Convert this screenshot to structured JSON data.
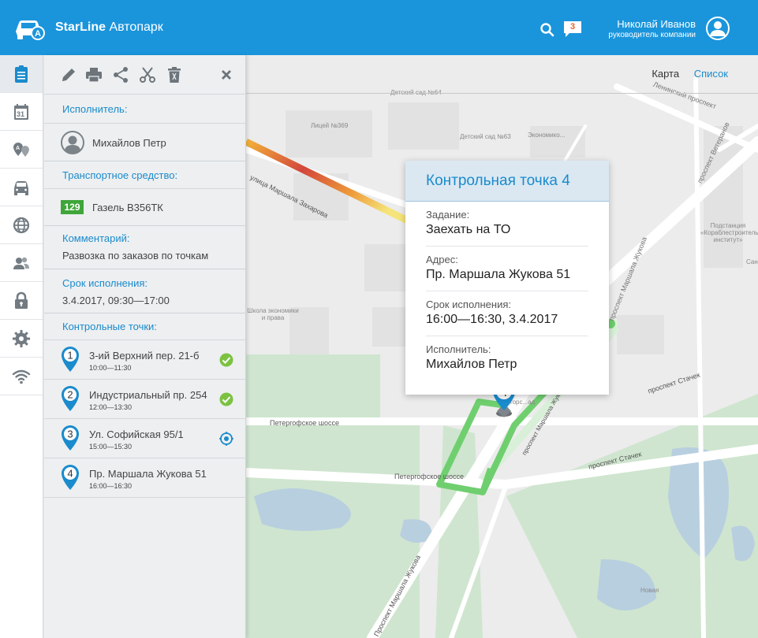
{
  "header": {
    "brand_bold": "StarLine",
    "brand_rest": " Автопарк",
    "messages_count": "3",
    "user_name": "Николай Иванов",
    "user_role": "руководитель компании"
  },
  "sidebar": {
    "items": [
      {
        "icon": "clipboard-icon",
        "active": true
      },
      {
        "icon": "calendar-icon",
        "label": "31"
      },
      {
        "icon": "route-ab-icon",
        "label": "A"
      },
      {
        "icon": "car-icon"
      },
      {
        "icon": "globe-icon"
      },
      {
        "icon": "users-icon"
      },
      {
        "icon": "lock-icon"
      },
      {
        "icon": "gear-icon"
      },
      {
        "icon": "wifi-icon"
      }
    ]
  },
  "panel": {
    "executor_label": "Исполнитель:",
    "executor_name": "Михайлов Петр",
    "vehicle_label": "Транспортное средство:",
    "vehicle_badge": "129",
    "vehicle_name": "Газель В356ТК",
    "comment_label": "Комментарий:",
    "comment_text": "Развозка по заказов по точкам",
    "deadline_label": "Срок исполнения:",
    "deadline_value": "3.4.2017, 09:30—17:00",
    "checkpoints_label": "Контрольные точки:",
    "checkpoints": [
      {
        "num": "1",
        "address": "3-ий Верхний пер. 21-б",
        "time": "10:00—11:30",
        "status": "done"
      },
      {
        "num": "2",
        "address": "Индустриальный пр. 254",
        "time": "12:00—13:30",
        "status": "done"
      },
      {
        "num": "3",
        "address": "Ул. Софийская 95/1",
        "time": "15:00—15:30",
        "status": "in-progress"
      },
      {
        "num": "4",
        "address": "Пр. Маршала Жукова 51",
        "time": "16:00—16:30",
        "status": "pending"
      }
    ]
  },
  "map": {
    "tab_map": "Карта",
    "tab_list": "Список",
    "labels": {
      "leninsky": "Ленинский проспект",
      "kindergarten64": "Детский сад №64",
      "lyceum369": "Лицей №369",
      "kindergarten63": "Детский сад №63",
      "economics": "Экономико...",
      "zakharova": "улица Маршала Захарова",
      "shipbuilding": "Подстанция «Кораблестроительный институт»",
      "veterans": "проспект Ветеранов",
      "zhukova_pr": "проспект Маршала Жукова",
      "school_econ": "Школа экономики и права",
      "stachek1": "проспект Стачек",
      "peterhof1": "Петергофское шоссе",
      "peterhof2": "Петергофское шоссе",
      "stachek2": "проспект Стачек",
      "zhukova_road": "Проспект Маршала Жукова",
      "novaya": "Новая",
      "zhukova_route": "проспект Маршала Жукова",
      "stores": "сторс...ад",
      "san": "Сан..."
    },
    "marker_number": "4"
  },
  "popup": {
    "title": "Контрольная точка 4",
    "task_label": "Задание:",
    "task_value": "Заехать на ТО",
    "address_label": "Адрес:",
    "address_value": "Пр. Маршала Жукова 51",
    "deadline_label": "Срок исполнения:",
    "deadline_value": "16:00—16:30, 3.4.2017",
    "executor_label": "Исполнитель:",
    "executor_value": "Михайлов Петр"
  },
  "colors": {
    "accent": "#1a95dc",
    "link": "#1a8bcc",
    "done": "#7cc242",
    "badge": "#3fa63a",
    "route": "#6fcf6f",
    "notify": "#e8632c"
  }
}
